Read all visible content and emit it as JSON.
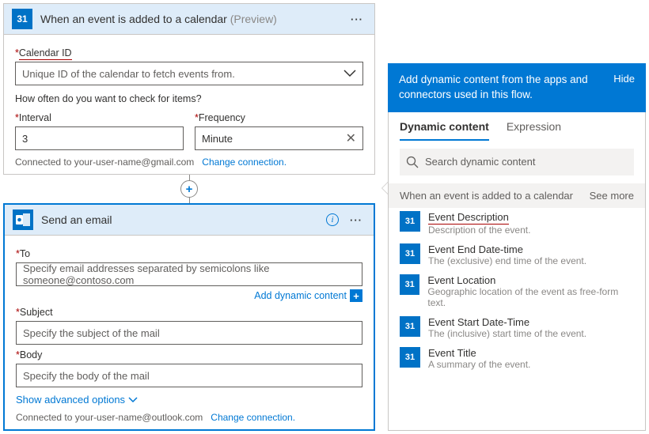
{
  "trigger": {
    "title": "When an event is added to a calendar",
    "preview_suffix": "(Preview)",
    "icon_text": "31",
    "calendar_id_label": "Calendar ID",
    "calendar_id_placeholder": "Unique ID of the calendar to fetch events from.",
    "check_label": "How often do you want to check for items?",
    "interval_label": "Interval",
    "interval_value": "3",
    "frequency_label": "Frequency",
    "frequency_value": "Minute",
    "connected_text": "Connected to your-user-name@gmail.com",
    "change_link": "Change connection."
  },
  "action": {
    "title": "Send an email",
    "to_label": "To",
    "to_placeholder": "Specify email addresses separated by semicolons like someone@contoso.com",
    "subject_label": "Subject",
    "subject_placeholder": "Specify the subject of the mail",
    "body_label": "Body",
    "body_placeholder": "Specify the body of the mail",
    "add_dynamic": "Add dynamic content",
    "show_advanced": "Show advanced options",
    "connected_text": "Connected to your-user-name@outlook.com",
    "change_link": "Change connection."
  },
  "dynamic": {
    "banner_msg": "Add dynamic content from the apps and connectors used in this flow.",
    "hide": "Hide",
    "tabs": {
      "content": "Dynamic content",
      "expression": "Expression"
    },
    "search_placeholder": "Search dynamic content",
    "group_title": "When an event is added to a calendar",
    "see_more": "See more",
    "icon_text": "31",
    "items": [
      {
        "title": "Event Description",
        "desc": "Description of the event.",
        "underline": true
      },
      {
        "title": "Event End Date-time",
        "desc": "The (exclusive) end time of the event."
      },
      {
        "title": "Event Location",
        "desc": "Geographic location of the event as free-form text."
      },
      {
        "title": "Event Start Date-Time",
        "desc": "The (inclusive) start time of the event."
      },
      {
        "title": "Event Title",
        "desc": "A summary of the event."
      }
    ]
  }
}
